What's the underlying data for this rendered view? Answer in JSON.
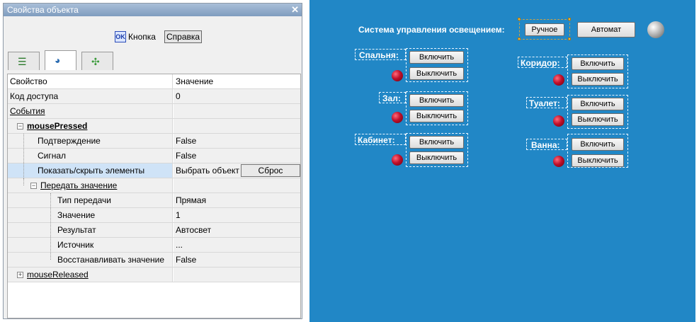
{
  "panel": {
    "title": "Свойства объекта",
    "close_glyph": "✕",
    "ok_icon": "OK",
    "object_label": "Кнопка",
    "help_label": "Справка",
    "tabs": [
      {
        "icon": "list-icon",
        "glyph": "☰"
      },
      {
        "icon": "palette-icon",
        "glyph": "◕"
      },
      {
        "icon": "event-icon",
        "glyph": "✣"
      }
    ],
    "grid": {
      "headers": [
        "Свойство",
        "Значение"
      ],
      "rows": [
        {
          "name": "Код доступа",
          "value": "0"
        },
        {
          "name": "События",
          "value": ""
        },
        {
          "name": "mousePressed",
          "value": ""
        },
        {
          "name": "Подтверждение",
          "value": "False"
        },
        {
          "name": "Сигнал",
          "value": "False"
        },
        {
          "name": "Показать/скрыть элементы",
          "value": "Выбрать объект"
        },
        {
          "name": "Передать значение",
          "value": ""
        },
        {
          "name": "Тип передачи",
          "value": "Прямая"
        },
        {
          "name": "Значение",
          "value": "1"
        },
        {
          "name": "Результат",
          "value": "Автосвет"
        },
        {
          "name": "Источник",
          "value": "..."
        },
        {
          "name": "Восстанавливать значение",
          "value": "False"
        },
        {
          "name": "mouseReleased",
          "value": ""
        }
      ],
      "reset_label": "Сброс",
      "expand_minus": "−",
      "expand_plus": "+"
    }
  },
  "canvas": {
    "title": "Система управления освещением:",
    "manual_label": "Ручное",
    "auto_label": "Автомат",
    "on_label": "Включить",
    "off_label": "Выключить",
    "rooms": [
      "Спальня:",
      "Зал:",
      "Кабинет:",
      "Коридор:",
      "Туалет:",
      "Ванна:"
    ],
    "colors": {
      "background": "#2187c6",
      "led": "#c0102b"
    }
  }
}
